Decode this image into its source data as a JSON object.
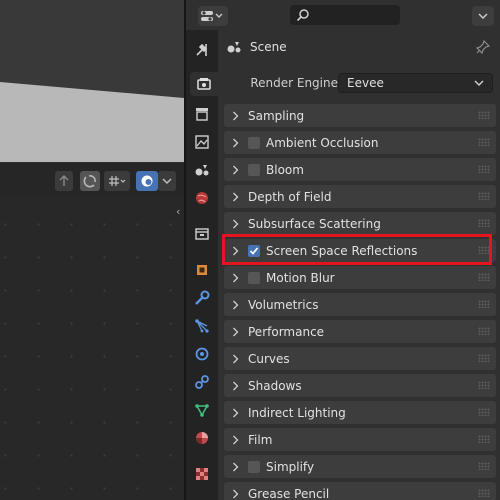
{
  "properties": {
    "context": {
      "label": "Scene",
      "icon": "scene-icon",
      "pin_icon": "pin-icon"
    },
    "render_engine": {
      "label": "Render Engine",
      "value": "Eevee"
    },
    "panels": [
      {
        "label": "Sampling",
        "has_checkbox": false,
        "checked": false
      },
      {
        "label": "Ambient Occlusion",
        "has_checkbox": true,
        "checked": false
      },
      {
        "label": "Bloom",
        "has_checkbox": true,
        "checked": false
      },
      {
        "label": "Depth of Field",
        "has_checkbox": false,
        "checked": false
      },
      {
        "label": "Subsurface Scattering",
        "has_checkbox": false,
        "checked": false
      },
      {
        "label": "Screen Space Reflections",
        "has_checkbox": true,
        "checked": true,
        "highlighted": true
      },
      {
        "label": "Motion Blur",
        "has_checkbox": true,
        "checked": false
      },
      {
        "label": "Volumetrics",
        "has_checkbox": false,
        "checked": false
      },
      {
        "label": "Performance",
        "has_checkbox": false,
        "checked": false
      },
      {
        "label": "Curves",
        "has_checkbox": false,
        "checked": false
      },
      {
        "label": "Shadows",
        "has_checkbox": false,
        "checked": false
      },
      {
        "label": "Indirect Lighting",
        "has_checkbox": false,
        "checked": false
      },
      {
        "label": "Film",
        "has_checkbox": false,
        "checked": false
      },
      {
        "label": "Simplify",
        "has_checkbox": true,
        "checked": false
      },
      {
        "label": "Grease Pencil",
        "has_checkbox": false,
        "checked": false
      }
    ],
    "tabs": [
      {
        "name": "tool-icon",
        "active": false
      },
      {
        "name": "render-icon",
        "active": true
      },
      {
        "name": "output-icon",
        "active": false
      },
      {
        "name": "view-layer-icon",
        "active": false
      },
      {
        "name": "scene-icon",
        "active": false
      },
      {
        "name": "world-icon",
        "active": false
      },
      {
        "name": "collection-icon",
        "active": false
      },
      {
        "name": "object-icon",
        "active": false
      },
      {
        "name": "modifier-icon",
        "active": false
      },
      {
        "name": "particles-icon",
        "active": false
      },
      {
        "name": "physics-icon",
        "active": false
      },
      {
        "name": "constraints-icon",
        "active": false
      },
      {
        "name": "data-icon",
        "active": false
      },
      {
        "name": "material-icon",
        "active": false
      },
      {
        "name": "texture-icon",
        "active": false
      }
    ]
  },
  "colors": {
    "highlight": "#e3151f",
    "checkbox_on": "#4772b3",
    "panel_bg": "#3d3d3d",
    "editor_bg": "#303030"
  }
}
